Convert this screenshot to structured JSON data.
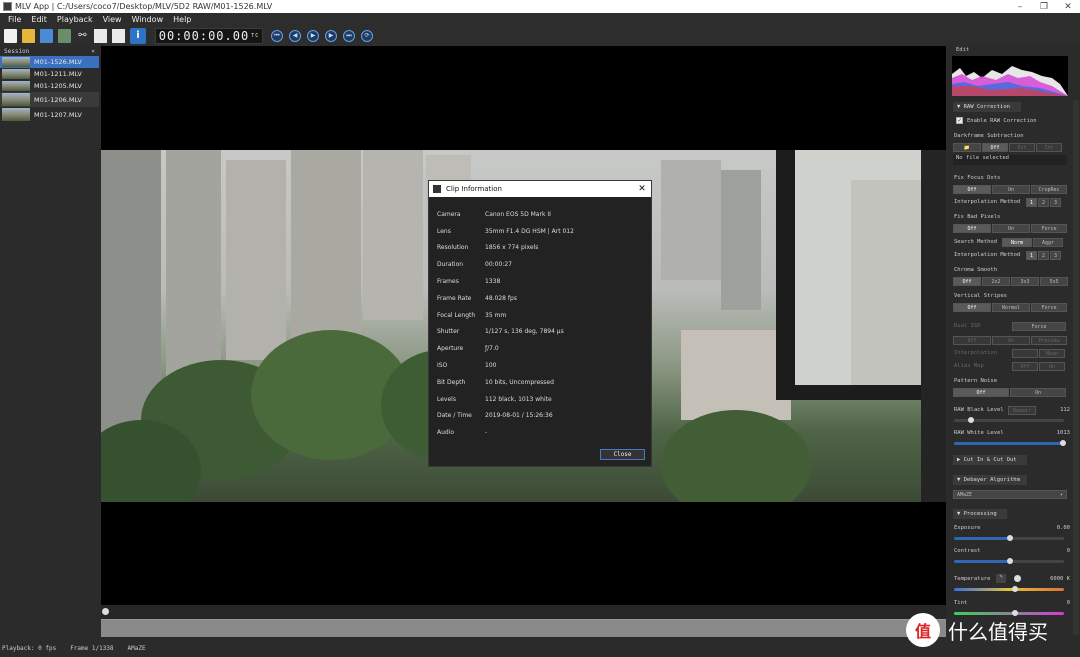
{
  "window": {
    "title": "MLV App | C:/Users/coco7/Desktop/MLV/5D2 RAW/M01-1526.MLV",
    "min": "–",
    "max": "❐",
    "close": "✕"
  },
  "menu": [
    "File",
    "Edit",
    "Playback",
    "View",
    "Window",
    "Help"
  ],
  "toolbar": {
    "timecode": "00:00:00.00",
    "timecode_sup": "TC"
  },
  "session": {
    "title": "Session",
    "close": "×",
    "clips": [
      "M01-1526.MLV",
      "M01-1211.MLV",
      "M01-1205.MLV",
      "M01-1206.MLV",
      "M01-1207.MLV"
    ]
  },
  "dialog": {
    "title": "Clip Information",
    "close_x": "✕",
    "rows": [
      {
        "k": "Camera",
        "v": "Canon EOS 5D Mark II"
      },
      {
        "k": "Lens",
        "v": "35mm F1.4 DG HSM | Art 012"
      },
      {
        "k": "Resolution",
        "v": "1856 x 774 pixels"
      },
      {
        "k": "Duration",
        "v": "00:00:27"
      },
      {
        "k": "Frames",
        "v": "1338"
      },
      {
        "k": "Frame Rate",
        "v": "48.028 fps"
      },
      {
        "k": "Focal Length",
        "v": "35 mm"
      },
      {
        "k": "Shutter",
        "v": "1/127 s,  136 deg,  7894 µs"
      },
      {
        "k": "Aperture",
        "v": "ƒ/7.0"
      },
      {
        "k": "ISO",
        "v": "100"
      },
      {
        "k": "Bit Depth",
        "v": "10 bits,  Uncompressed"
      },
      {
        "k": "Levels",
        "v": "112 black,  1013 white"
      },
      {
        "k": "Date / Time",
        "v": "2019-08-01 / 15:26:36"
      },
      {
        "k": "Audio",
        "v": "-"
      }
    ],
    "close_btn": "Close"
  },
  "status": {
    "playback": "Playback: 0 fps",
    "frame": "Frame 1/1338",
    "debayer": "AMaZE"
  },
  "edit": {
    "title": "Edit",
    "raw_correction": "RAW Correction",
    "enable_raw": "Enable RAW Correction",
    "darkframe": "Darkframe Subtraction",
    "df_opts": [
      "📁",
      "Off",
      "Ext",
      "Int"
    ],
    "no_file": "No file selected",
    "focus_dots": "Fix Focus Dots",
    "fd_opts": [
      "Off",
      "On",
      "CropRec"
    ],
    "interp_method": "Interpolation Method",
    "interp_opts": [
      "1",
      "2",
      "3"
    ],
    "bad_pixels": "Fix Bad Pixels",
    "bp_opts": [
      "Off",
      "On",
      "Force"
    ],
    "search_method": "Search Method",
    "sm_opts": [
      "Norm",
      "Aggr"
    ],
    "interp_method2": "Interpolation Method",
    "chroma_smooth": "Chroma Smooth",
    "cs_opts": [
      "Off",
      "2x2",
      "3x3",
      "5x5"
    ],
    "vertical_stripes": "Vertical Stripes",
    "vs_opts": [
      "Off",
      "Normal",
      "Force"
    ],
    "dual_iso": "Dual ISO",
    "dual_force": "Force",
    "di_opts": [
      "Off",
      "On",
      "Preview"
    ],
    "di_interp": "Interpolation",
    "di_interp_opt": "Mean",
    "alias_map": "Alias Map",
    "am_opts": [
      "Off",
      "On"
    ],
    "pattern_noise": "Pattern Noise",
    "pn_opts": [
      "Off",
      "On"
    ],
    "black_level": "RAW Black Level",
    "repair": "Repair",
    "black_val": "112",
    "white_level": "RAW White Level",
    "white_val": "1013",
    "cut_in_out": "Cut In & Cut Out",
    "debayer": "Debayer Algorithm",
    "debayer_val": "AMaZE",
    "processing": "Processing",
    "exposure": "Exposure",
    "exposure_val": "0.00",
    "contrast": "Contrast",
    "contrast_val": "0",
    "temperature": "Temperature",
    "temperature_val": "6000 K",
    "tint": "Tint",
    "tint_val": "0"
  },
  "watermark": {
    "circle": "值",
    "text": "什么值得买"
  }
}
